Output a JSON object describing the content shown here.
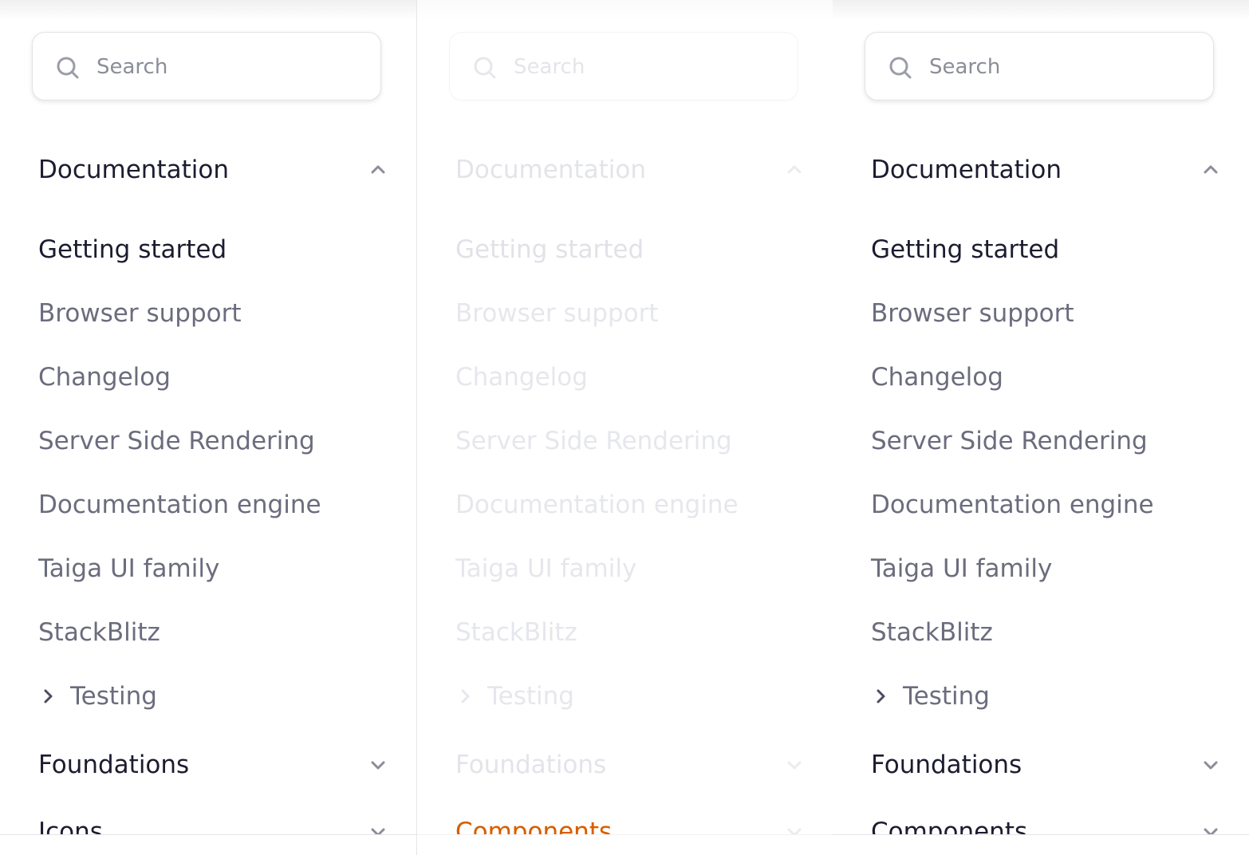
{
  "search": {
    "placeholder": "Search"
  },
  "nav": {
    "documentation": {
      "title": "Documentation",
      "items": [
        "Getting started",
        "Browser support",
        "Changelog",
        "Server Side Rendering",
        "Documentation engine",
        "Taiga UI family",
        "StackBlitz"
      ],
      "sub_item": "Testing"
    },
    "foundations": "Foundations",
    "panel1_next": "Icons",
    "panel2_next": "Components",
    "panel3_next": "Components"
  },
  "colors": {
    "heading": "#1c1c30",
    "item": "#6b6c7d",
    "placeholder": "#8b8d98",
    "faded": "#e4e5ea",
    "glitch_yellow": "#e8b100",
    "glitch_red": "#d23a00"
  },
  "icons": {
    "search": "search-icon",
    "collapse": "chevron-up-icon",
    "expand": "chevron-down-icon",
    "sub_expand": "chevron-right-icon"
  }
}
